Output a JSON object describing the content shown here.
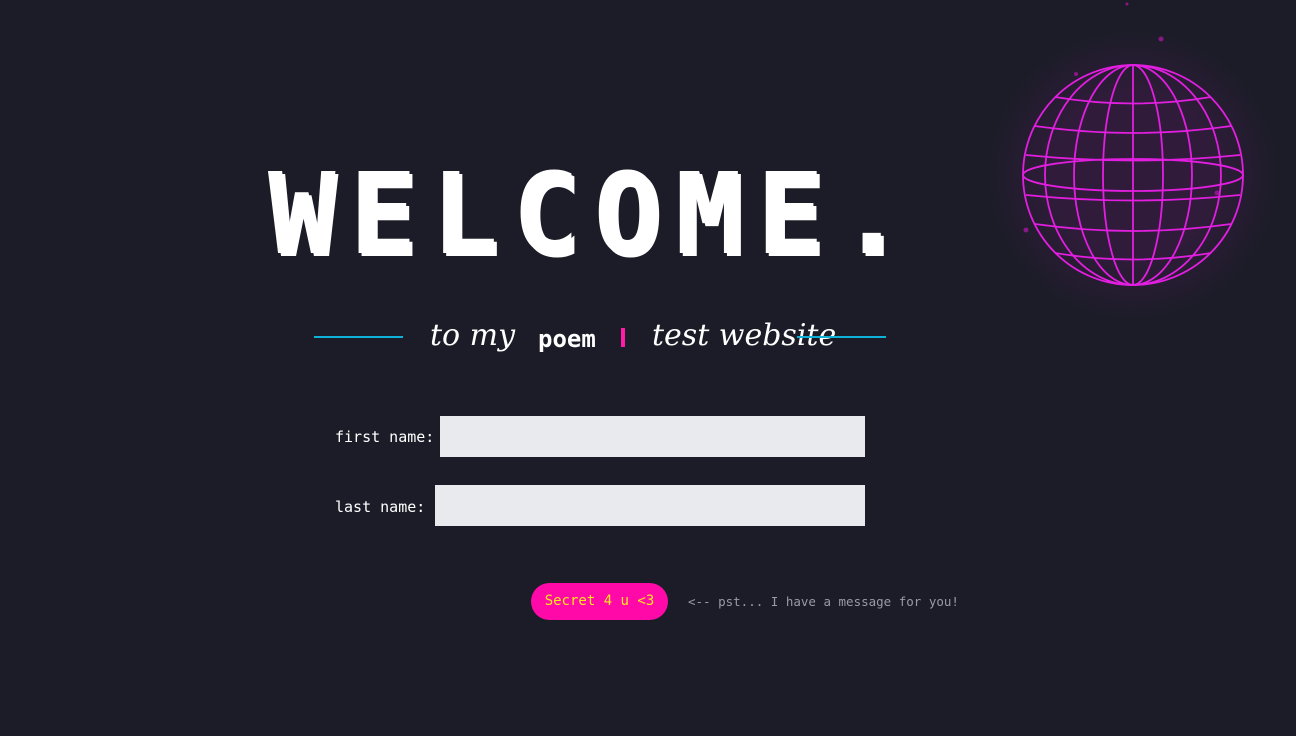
{
  "hero": {
    "title": "WELCOME.",
    "subtitle_before": "to my",
    "typed_word": "poem",
    "subtitle_after": "test website"
  },
  "form": {
    "first_name_label": "first name:",
    "last_name_label": "last name:",
    "first_name_value": "",
    "last_name_value": ""
  },
  "secret": {
    "button_label": "Secret 4 u <3",
    "hint_text": "<-- pst... I have a message for you!"
  },
  "colors": {
    "background": "#1c1c28",
    "accent_pink": "#ff0aa8",
    "accent_cyan": "#0fb2d6",
    "globe_magenta": "#e21ee0",
    "button_text_yellow": "#ffe81a",
    "input_background": "#e8eaee"
  },
  "icons": {
    "globe": "wireframe-globe-icon",
    "cursor": "typing-cursor"
  }
}
